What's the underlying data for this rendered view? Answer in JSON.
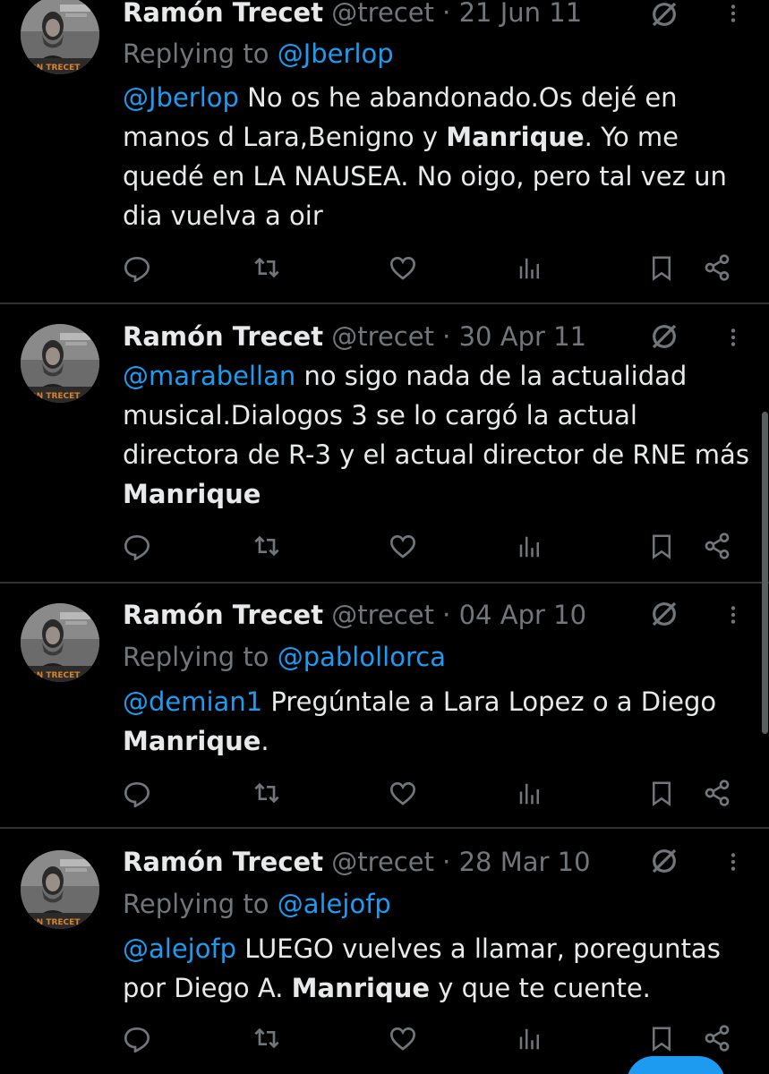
{
  "colors": {
    "background": "#000000",
    "text": "#e7e9ea",
    "muted": "#71767b",
    "link": "#1d9bf0",
    "divider": "#2f3336"
  },
  "icons": {
    "reply": "speech-bubble",
    "retweet": "two-arrows-loop",
    "like": "heart",
    "views": "bar-chart",
    "bookmark": "bookmark",
    "share": "share-nodes",
    "grok": "circle-slash",
    "more": "vertical-dots"
  },
  "tweets": [
    {
      "name": "Ramón Trecet",
      "handle": "@trecet",
      "sep": "·",
      "date": "21 Jun 11",
      "reply_prefix": "Replying to",
      "reply_to": "@Jberlop",
      "mention": "@Jberlop",
      "text_a": " No os he abandonado.Os dejé en manos d Lara,Benigno y ",
      "bold": "Manrique",
      "text_b": ". Yo me quedé en LA NAUSEA. No oigo, pero tal vez un dia vuelva a oir"
    },
    {
      "name": "Ramón Trecet",
      "handle": "@trecet",
      "sep": "·",
      "date": "30 Apr 11",
      "mention": "@marabellan",
      "text_a": " no sigo nada de la actualidad musical.Dialogos 3 se lo cargó la actual directora de R-3 y el actual director de RNE más ",
      "bold": "Manrique",
      "text_b": ""
    },
    {
      "name": "Ramón Trecet",
      "handle": "@trecet",
      "sep": "·",
      "date": "04 Apr 10",
      "reply_prefix": "Replying to",
      "reply_to": "@pablollorca",
      "mention": "@demian1",
      "text_a": " Pregúntale a Lara Lopez o a Diego ",
      "bold": "Manrique",
      "text_b": "."
    },
    {
      "name": "Ramón Trecet",
      "handle": "@trecet",
      "sep": "·",
      "date": "28 Mar 10",
      "reply_prefix": "Replying to",
      "reply_to": "@alejofp",
      "mention": "@alejofp",
      "text_a": "  LUEGO vuelves a llamar, poreguntas por Diego A. ",
      "bold": "Manrique",
      "text_b": " y que te cuente."
    }
  ]
}
